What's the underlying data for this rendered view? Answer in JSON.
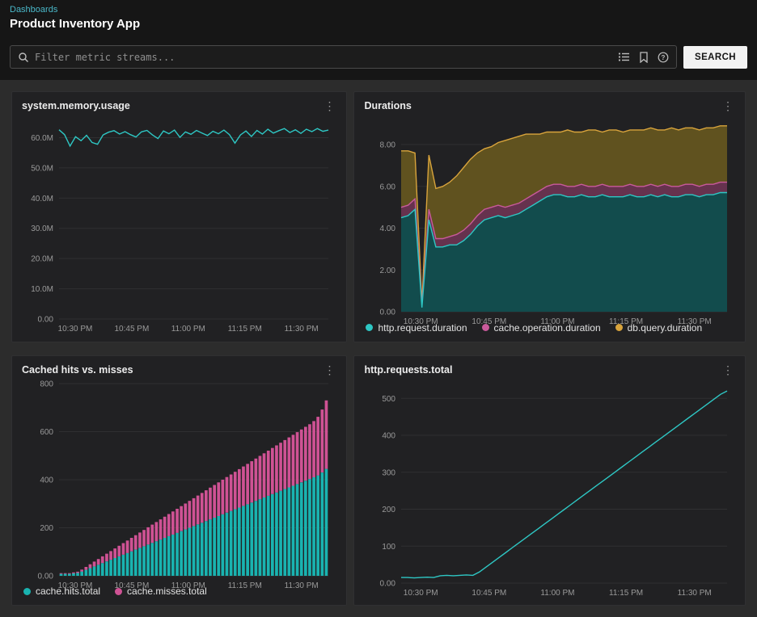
{
  "breadcrumb": "Dashboards",
  "page_title": "Product Inventory App",
  "search": {
    "placeholder": "Filter metric streams...",
    "button_label": "SEARCH",
    "icons": [
      "search-icon",
      "list-view-icon",
      "bookmark-icon",
      "help-icon"
    ]
  },
  "colors": {
    "teal": "#2ec7c4",
    "pink": "#cf5294",
    "gold": "#d9a43c",
    "accent_breadcrumb": "#4ab8c9"
  },
  "chart_data": [
    {
      "type": "line",
      "title": "system.memory.usage",
      "legend": false,
      "ylim": [
        0,
        66
      ],
      "yticks": [
        0,
        10,
        20,
        30,
        40,
        50,
        60
      ],
      "ytick_labels": [
        "0.00",
        "10.0M",
        "20.0M",
        "30.0M",
        "40.0M",
        "50.0M",
        "60.0M"
      ],
      "xtick_pos": [
        0.06,
        0.27,
        0.48,
        0.69,
        0.9
      ],
      "xtick_labels": [
        "10:30 PM",
        "10:45 PM",
        "11:00 PM",
        "11:15 PM",
        "11:30 PM"
      ],
      "series": [
        {
          "name": "system.memory.usage",
          "color": "#2ec7c4",
          "values": [
            62.6,
            61.0,
            57.2,
            60.3,
            59.0,
            60.8,
            58.4,
            57.8,
            60.9,
            61.8,
            62.3,
            61.2,
            62.0,
            61.0,
            60.2,
            61.9,
            62.4,
            60.9,
            59.7,
            62.2,
            61.3,
            62.5,
            60.1,
            61.9,
            61.1,
            62.4,
            61.5,
            60.7,
            62.1,
            61.3,
            62.5,
            61.0,
            58.2,
            60.9,
            62.2,
            60.4,
            62.4,
            61.2,
            62.8,
            61.5,
            62.3,
            63.0,
            61.7,
            62.6,
            61.4,
            62.8,
            62.0,
            63.0,
            62.1,
            62.5
          ]
        }
      ]
    },
    {
      "type": "area",
      "title": "Durations",
      "legend": true,
      "ylim": [
        0,
        9.2
      ],
      "yticks": [
        0,
        2,
        4,
        6,
        8
      ],
      "ytick_labels": [
        "0.00",
        "2.00",
        "4.00",
        "6.00",
        "8.00"
      ],
      "xtick_pos": [
        0.06,
        0.27,
        0.48,
        0.69,
        0.9
      ],
      "xtick_labels": [
        "10:30 PM",
        "10:45 PM",
        "11:00 PM",
        "11:15 PM",
        "11:30 PM"
      ],
      "series": [
        {
          "name": "http.request.duration",
          "color": "#2ec7c4",
          "fill": "#124c4d",
          "values": [
            4.5,
            4.6,
            4.9,
            0.2,
            4.4,
            3.1,
            3.1,
            3.2,
            3.2,
            3.4,
            3.7,
            4.1,
            4.4,
            4.5,
            4.6,
            4.5,
            4.6,
            4.7,
            4.9,
            5.1,
            5.3,
            5.5,
            5.6,
            5.6,
            5.5,
            5.5,
            5.6,
            5.5,
            5.5,
            5.6,
            5.5,
            5.5,
            5.5,
            5.6,
            5.5,
            5.5,
            5.6,
            5.5,
            5.6,
            5.5,
            5.5,
            5.6,
            5.6,
            5.5,
            5.6,
            5.6,
            5.7,
            5.7
          ]
        },
        {
          "name": "cache.operation.duration",
          "color": "#c95a9b",
          "fill": "#66324e",
          "values": [
            5.0,
            5.1,
            5.4,
            0.3,
            4.9,
            3.5,
            3.5,
            3.6,
            3.7,
            3.9,
            4.2,
            4.6,
            4.9,
            5.0,
            5.1,
            5.0,
            5.1,
            5.2,
            5.4,
            5.6,
            5.8,
            6.0,
            6.1,
            6.1,
            6.0,
            6.0,
            6.1,
            6.0,
            6.0,
            6.1,
            6.0,
            6.0,
            6.0,
            6.1,
            6.0,
            6.0,
            6.1,
            6.0,
            6.1,
            6.0,
            6.0,
            6.1,
            6.1,
            6.0,
            6.1,
            6.1,
            6.2,
            6.2
          ]
        },
        {
          "name": "db.query.duration",
          "color": "#d9a43c",
          "fill": "#60521f",
          "values": [
            7.7,
            7.7,
            7.6,
            0.4,
            7.5,
            5.9,
            6.0,
            6.2,
            6.5,
            6.9,
            7.3,
            7.6,
            7.8,
            7.9,
            8.1,
            8.2,
            8.3,
            8.4,
            8.5,
            8.5,
            8.5,
            8.6,
            8.6,
            8.6,
            8.7,
            8.6,
            8.6,
            8.7,
            8.7,
            8.6,
            8.7,
            8.7,
            8.6,
            8.7,
            8.7,
            8.7,
            8.8,
            8.7,
            8.7,
            8.8,
            8.7,
            8.8,
            8.8,
            8.7,
            8.8,
            8.8,
            8.9,
            8.9
          ]
        }
      ]
    },
    {
      "type": "stacked-bar",
      "title": "Cached hits vs. misses",
      "legend": true,
      "ylim": [
        0,
        800
      ],
      "yticks": [
        0,
        200,
        400,
        600,
        800
      ],
      "ytick_labels": [
        "0.00",
        "200",
        "400",
        "600",
        "800"
      ],
      "xtick_pos": [
        0.06,
        0.27,
        0.48,
        0.69,
        0.9
      ],
      "xtick_labels": [
        "10:30 PM",
        "10:45 PM",
        "11:00 PM",
        "11:15 PM",
        "11:30 PM"
      ],
      "series": [
        {
          "name": "cache.hits.total",
          "color": "#19b3b0",
          "values": [
            8,
            8,
            8,
            10,
            12,
            18,
            25,
            32,
            39,
            46,
            53,
            60,
            67,
            74,
            81,
            88,
            95,
            102,
            109,
            116,
            123,
            130,
            137,
            144,
            151,
            158,
            165,
            172,
            179,
            186,
            193,
            200,
            207,
            214,
            221,
            228,
            235,
            242,
            249,
            256,
            263,
            270,
            277,
            284,
            291,
            298,
            305,
            312,
            319,
            326,
            333,
            340,
            347,
            354,
            361,
            368,
            375,
            382,
            389,
            396,
            403,
            410,
            418,
            430,
            445
          ]
        },
        {
          "name": "cache.misses.total",
          "color": "#cf5294",
          "values": [
            3,
            3,
            3,
            4,
            5,
            8,
            12,
            16,
            20,
            24,
            28,
            32,
            36,
            40,
            44,
            48,
            52,
            56,
            60,
            64,
            68,
            72,
            76,
            80,
            84,
            88,
            92,
            96,
            100,
            104,
            108,
            112,
            116,
            120,
            124,
            128,
            132,
            136,
            140,
            144,
            148,
            152,
            156,
            160,
            164,
            168,
            172,
            176,
            180,
            184,
            188,
            192,
            196,
            200,
            204,
            208,
            212,
            216,
            220,
            224,
            228,
            234,
            244,
            262,
            285
          ]
        }
      ]
    },
    {
      "type": "line",
      "title": "http.requests.total",
      "legend": false,
      "ylim": [
        0,
        540
      ],
      "yticks": [
        0,
        100,
        200,
        300,
        400,
        500
      ],
      "ytick_labels": [
        "0.00",
        "100",
        "200",
        "300",
        "400",
        "500"
      ],
      "xtick_pos": [
        0.06,
        0.27,
        0.48,
        0.69,
        0.9
      ],
      "xtick_labels": [
        "10:30 PM",
        "10:45 PM",
        "11:00 PM",
        "11:15 PM",
        "11:30 PM"
      ],
      "series": [
        {
          "name": "http.requests.total",
          "color": "#2ec7c4",
          "values": [
            15,
            15,
            14,
            15,
            16,
            15,
            20,
            21,
            20,
            21,
            22,
            21,
            30,
            43,
            56,
            69,
            82,
            95,
            108,
            121,
            134,
            147,
            160,
            173,
            186,
            199,
            212,
            225,
            238,
            251,
            264,
            277,
            290,
            303,
            316,
            329,
            342,
            355,
            368,
            381,
            394,
            407,
            420,
            433,
            446,
            459,
            472,
            485,
            498,
            511,
            520
          ]
        }
      ]
    }
  ]
}
